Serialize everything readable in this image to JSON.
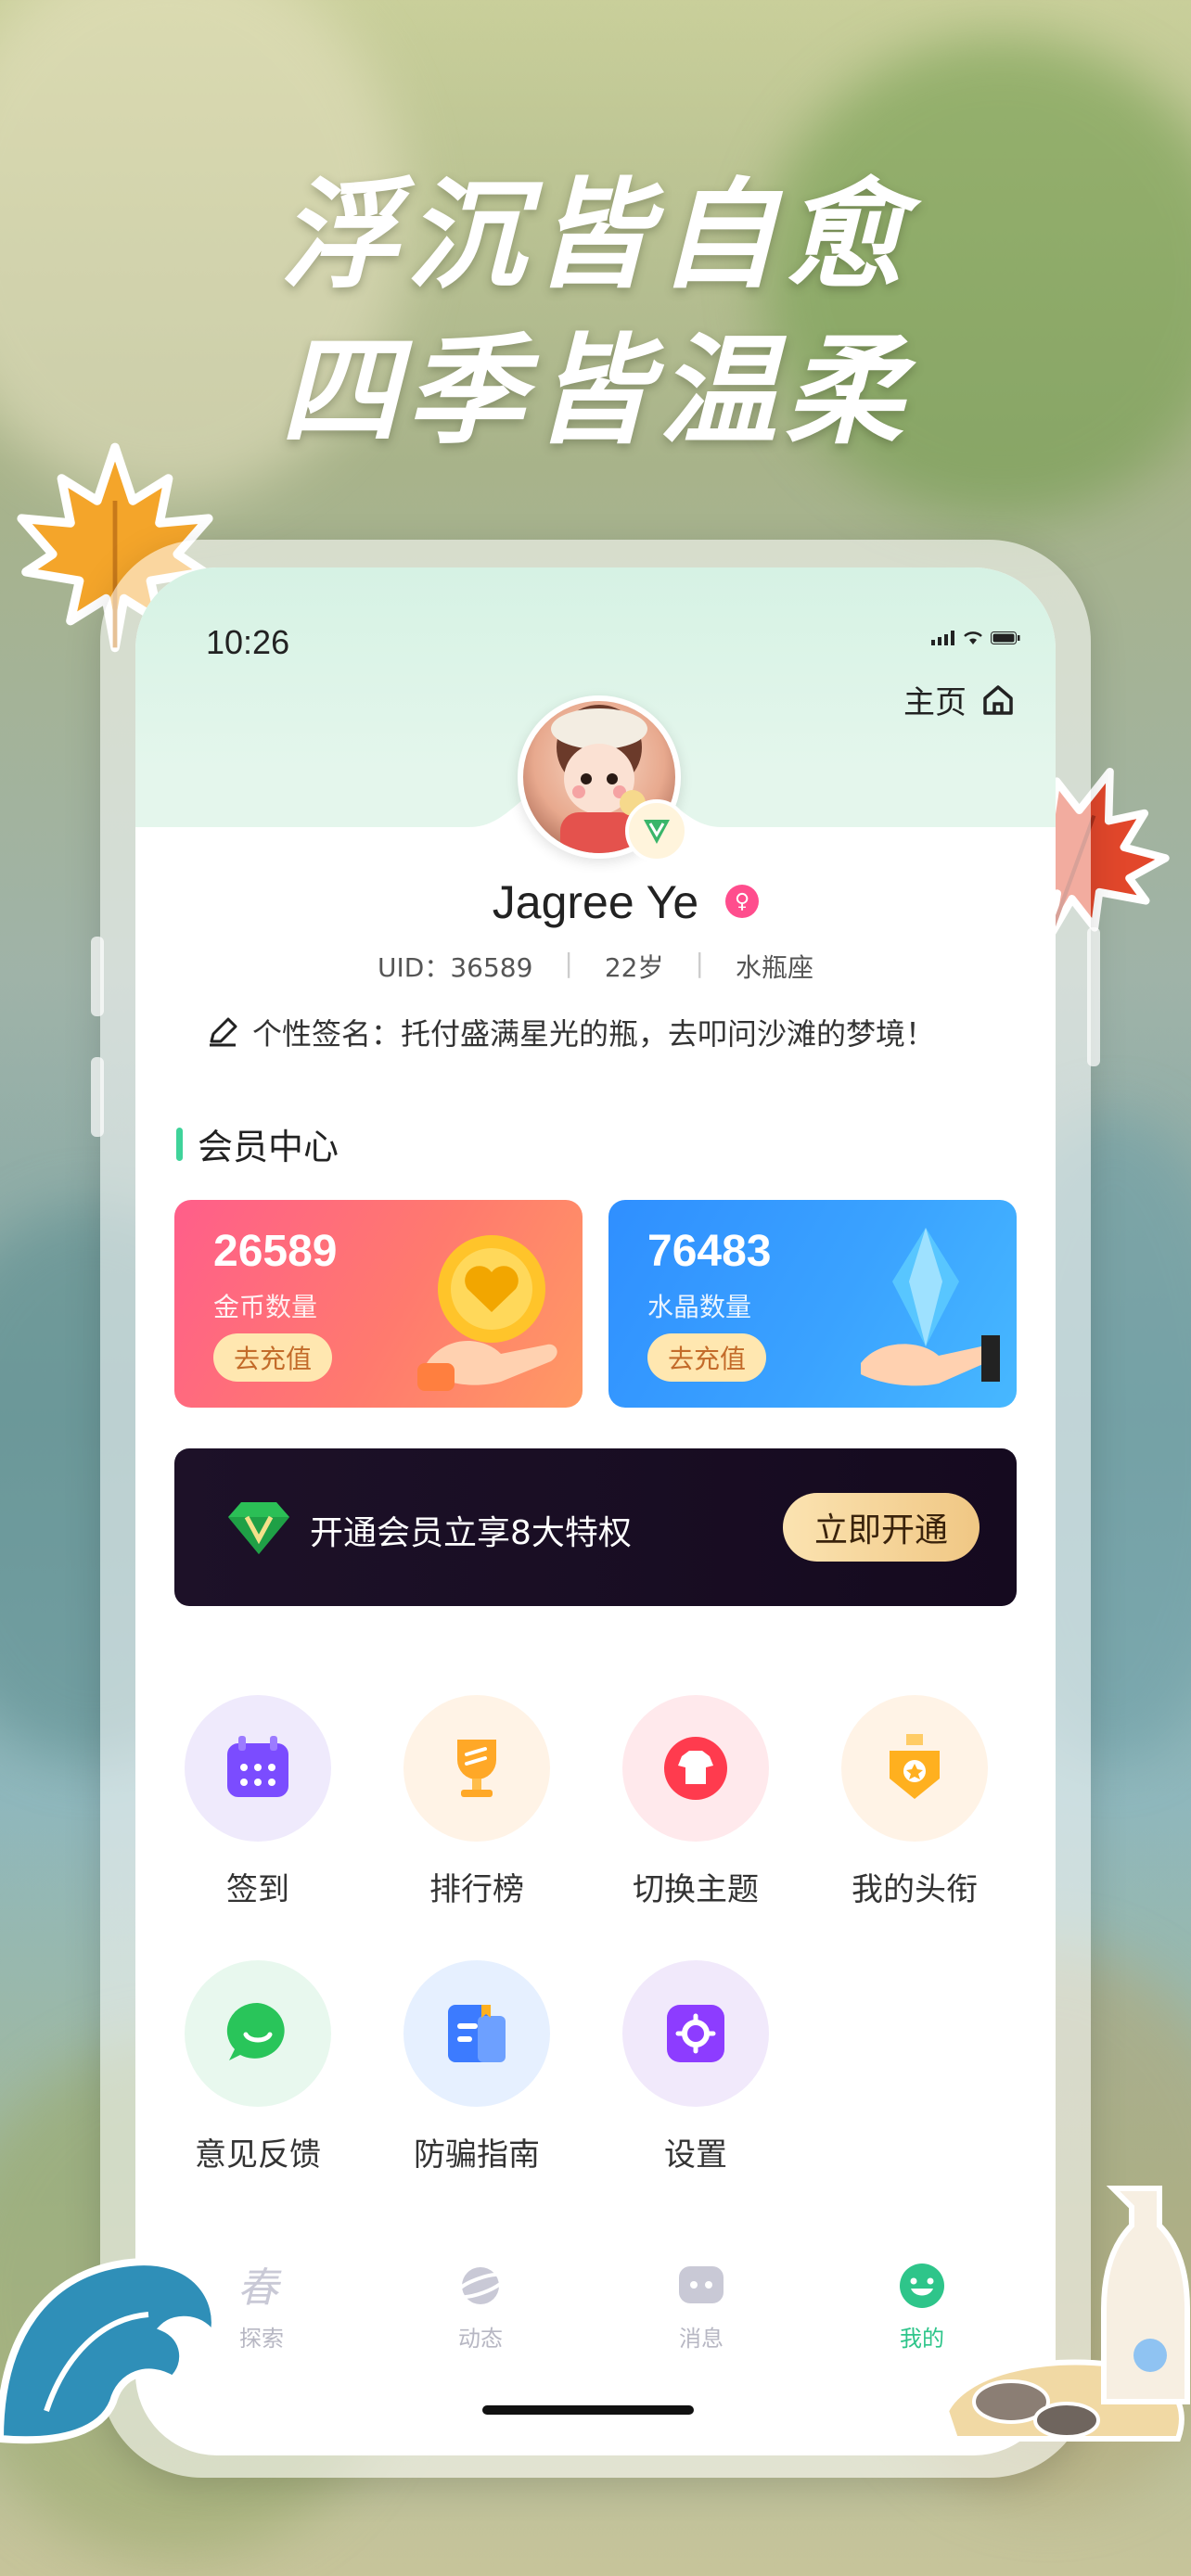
{
  "headline": {
    "line1": "浮沉皆自愈",
    "line2": "四季皆温柔"
  },
  "status_bar": {
    "time": "10:26"
  },
  "header": {
    "home_label": "主页"
  },
  "profile": {
    "name": "Jagree Ye",
    "uid": "UID：36589",
    "age": "22岁",
    "zodiac": "水瓶座",
    "signature": "个性签名：托付盛满星光的瓶，去叩问沙滩的梦境！"
  },
  "member_center": {
    "title": "会员中心",
    "coin": {
      "value": "26589",
      "label": "金币数量",
      "button": "去充值"
    },
    "crystal": {
      "value": "76483",
      "label": "水晶数量",
      "button": "去充值"
    },
    "vip": {
      "text": "开通会员立享8大特权",
      "button": "立即开通"
    }
  },
  "grid": [
    {
      "label": "签到",
      "icon": "calendar-icon",
      "bg": "#efeafc",
      "color": "#7b4cff"
    },
    {
      "label": "排行榜",
      "icon": "trophy-icon",
      "bg": "#fff3e6",
      "color": "#ffa827"
    },
    {
      "label": "切换主题",
      "icon": "shirt-icon",
      "bg": "#ffe9ec",
      "color": "#ff3b4e"
    },
    {
      "label": "我的头衔",
      "icon": "medal-icon",
      "bg": "#fff3e6",
      "color": "#ffb01f"
    },
    {
      "label": "意见反馈",
      "icon": "chat-icon",
      "bg": "#e8f8ee",
      "color": "#29c55a"
    },
    {
      "label": "防骗指南",
      "icon": "guide-book-icon",
      "bg": "#e6f0ff",
      "color": "#3c7bff"
    },
    {
      "label": "设置",
      "icon": "settings-icon",
      "bg": "#f1e9fb",
      "color": "#8d3cff"
    }
  ],
  "tabbar": {
    "tabs": [
      {
        "label": "探索",
        "icon": "explore-icon"
      },
      {
        "label": "动态",
        "icon": "planet-icon"
      },
      {
        "label": "消息",
        "icon": "message-icon"
      },
      {
        "label": "我的",
        "icon": "smile-icon",
        "active": true
      }
    ]
  },
  "colors": {
    "accent": "#2ec58a",
    "coin_card": "#ff6f7b",
    "crystal_card": "#3aa2ff",
    "vip_banner": "#1a0f24"
  }
}
